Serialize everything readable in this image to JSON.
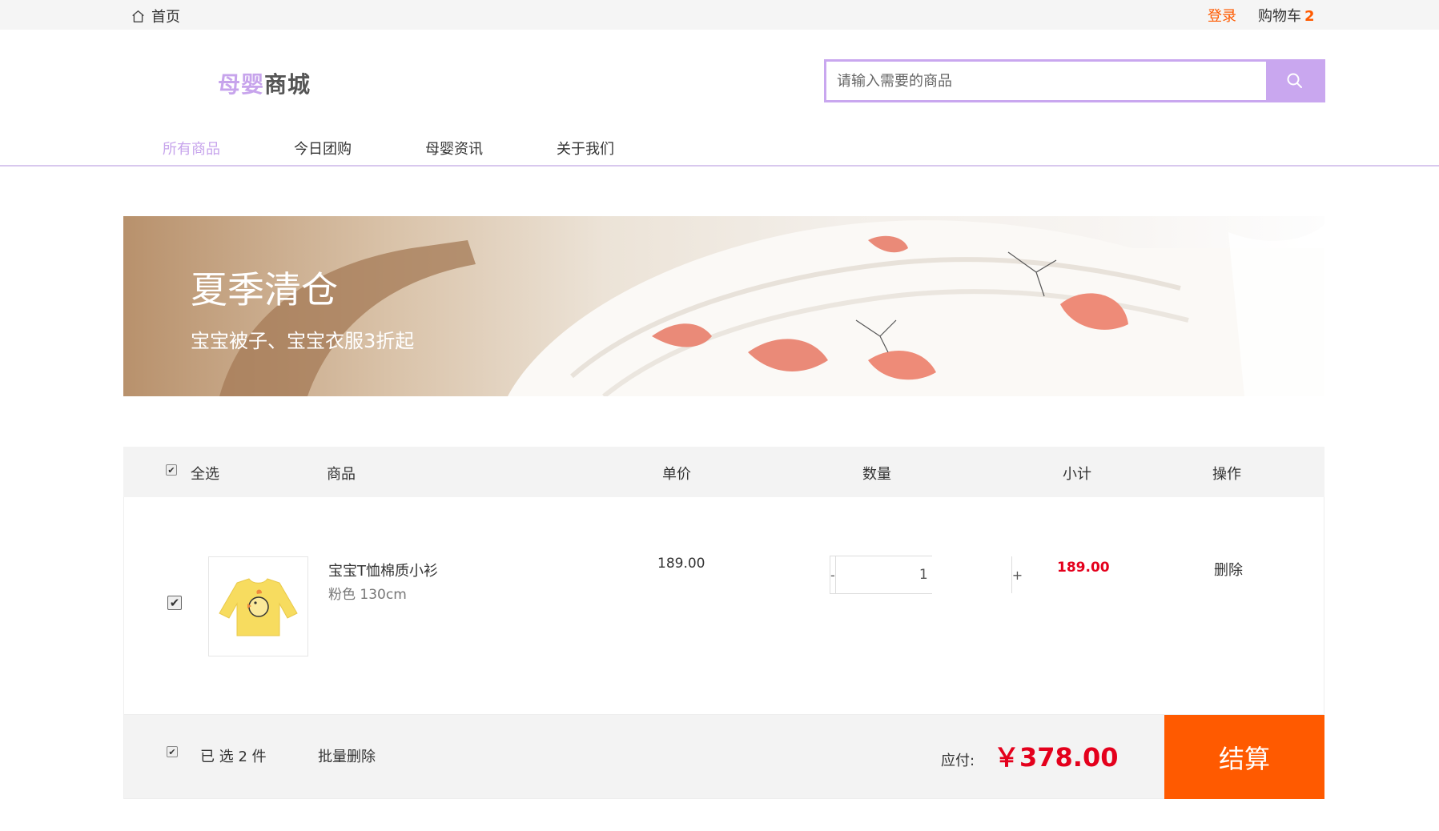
{
  "topbar": {
    "home_label": "首页",
    "login_label": "登录",
    "cart_label": "购物车",
    "cart_count": "2"
  },
  "header": {
    "logo_part1": "母婴",
    "logo_part2": "商城",
    "search": {
      "placeholder": "请输入需要的商品",
      "value": ""
    }
  },
  "nav": {
    "items": [
      {
        "label": "所有商品",
        "active": true
      },
      {
        "label": "今日团购"
      },
      {
        "label": "母婴资讯"
      },
      {
        "label": "关于我们"
      }
    ]
  },
  "banner": {
    "title": "夏季清仓",
    "subtitle": "宝宝被子、宝宝衣服3折起"
  },
  "cart": {
    "headers": {
      "select_all": "全选",
      "product": "商品",
      "unit_price": "单价",
      "quantity": "数量",
      "subtotal": "小计",
      "action": "操作"
    },
    "items": [
      {
        "name": "宝宝T恤棉质小衫",
        "spec": "粉色 130cm",
        "price": "189.00",
        "quantity": "1",
        "subtotal": "189.00",
        "delete_label": "删除",
        "checked": true
      }
    ],
    "qty_minus": "-",
    "qty_plus": "+",
    "footer": {
      "selected": "已 选 2 件",
      "batch_delete": "批量删除",
      "pay_label": "应付:",
      "total": "￥378.00",
      "checkout": "结算"
    }
  },
  "colors": {
    "accent": "#c9a7ef",
    "orange": "#ff5a00",
    "price_red": "#e4001c"
  }
}
